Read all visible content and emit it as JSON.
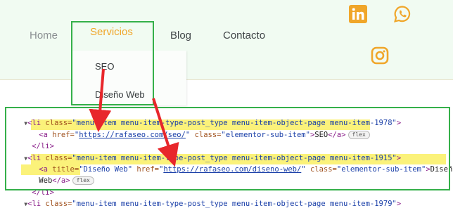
{
  "nav": {
    "items": [
      "Home",
      "Servicios",
      "Blog",
      "Contacto"
    ],
    "dropdown": [
      "SEO",
      "Diseño Web"
    ]
  },
  "social": {
    "icons": [
      "linkedin-icon",
      "whatsapp-icon",
      "instagram-icon"
    ]
  },
  "devtools": {
    "lines": [
      {
        "tri": "▼",
        "lt": "<li ",
        "an1": "class=",
        "av1": "\"menu-item menu-item-type-post_type menu-item-object-page menu-item-1978\"",
        "gt": ">"
      },
      {
        "a_open": "<a ",
        "href_name": "href=",
        "q1": "\"",
        "href": "https://rafaseo.com/seo/",
        "q2": "\" ",
        "class_name": "class=",
        "class_val": "\"elementor-sub-item\"",
        "gt": ">",
        "text": "SEO",
        "close": "</a>",
        "badge": "flex"
      },
      {
        "text": "</li>"
      },
      {
        "tri": "▼",
        "lt": "<li ",
        "an1": "class=",
        "av1": "\"menu-item menu-item-type-post_type menu-item-object-page menu-item-1915\"",
        "gt": ">"
      },
      {
        "a_open": "<a ",
        "title_name": "title=",
        "title_val": "\"Diseño Web\" ",
        "href_name": "href=",
        "q1": "\"",
        "href": "https://rafaseo.com/diseno-web/",
        "q2": "\" ",
        "class_name": "class=",
        "class_val": "\"elementor-sub-item\"",
        "gt": ">",
        "text": "Diseño"
      },
      {
        "text": "Web",
        "close": "</a>",
        "badge": "flex"
      },
      {
        "text": "</li>"
      },
      {
        "tri": "▼",
        "lt": "<li ",
        "an1": "class=",
        "av1": "\"menu-item menu-item-type-post_type menu-item-object-page menu-item-1979\"",
        "gt": ">"
      }
    ]
  },
  "colors": {
    "accent_orange": "#f0a62a",
    "highlight_green": "#35b04a",
    "arrow_red": "#e8272b",
    "highlight_yellow": "#fbf27a"
  }
}
